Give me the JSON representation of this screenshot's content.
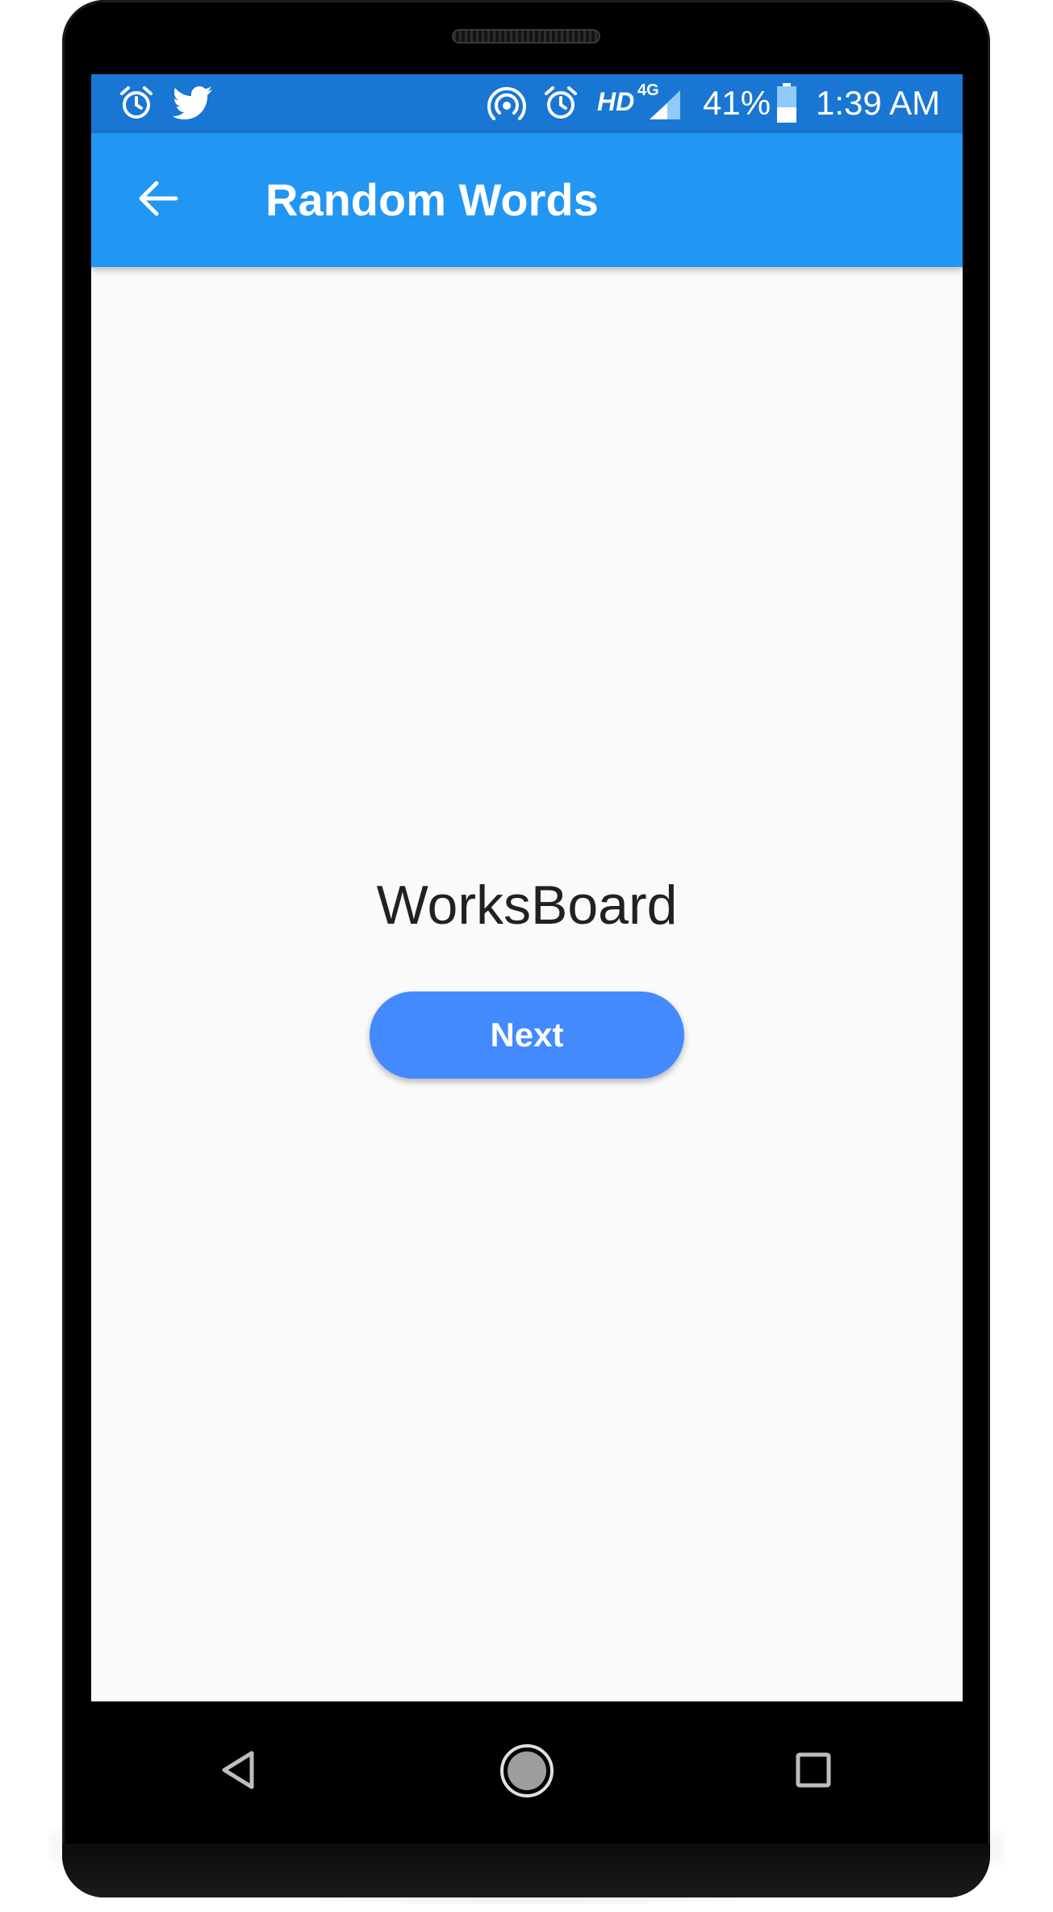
{
  "status_bar": {
    "network": "HD",
    "network_type": "4G",
    "battery": "41%",
    "time": "1:39 AM",
    "left_icons": [
      "alarm-icon",
      "twitter-icon"
    ],
    "right_icons": [
      "hotspot-icon",
      "alarm-icon",
      "signal-icon",
      "battery-icon"
    ],
    "battery_level": 0.41
  },
  "app_bar": {
    "title": "Random Words",
    "back_icon": "arrow-back-icon",
    "color": "#2196f3"
  },
  "content": {
    "word": "WorksBoard",
    "next_label": "Next",
    "button_color": "#448aff"
  },
  "nav_bar": {
    "icons": [
      "back-triangle-icon",
      "home-circle-icon",
      "recents-square-icon"
    ]
  }
}
